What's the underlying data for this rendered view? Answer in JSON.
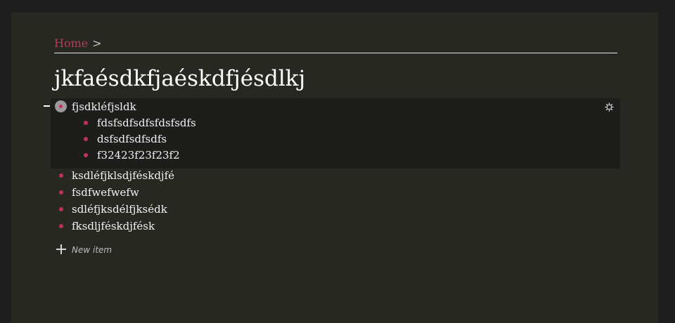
{
  "breadcrumb": {
    "home_label": "Home",
    "separator": ">"
  },
  "page": {
    "title": "jkfaésdkfjaéskdfjésdlkj"
  },
  "focused_item": {
    "label": "fjsdkléfjsldk",
    "children": [
      {
        "label": "fdsfsdfsdfsfdsfsdfs"
      },
      {
        "label": "dsfsdfsdfsdfs"
      },
      {
        "label": "f32423f23f23f2"
      }
    ]
  },
  "items": [
    {
      "label": "ksdléfjklsdjféskdjfé"
    },
    {
      "label": "fsdfwefwefw"
    },
    {
      "label": "sdléfjksdélfjksédk"
    },
    {
      "label": "fksdljféskdjfésk"
    }
  ],
  "new_item": {
    "label": "New item",
    "icon": "plus-icon"
  },
  "icons": {
    "collapse": "minus-icon",
    "settings": "gear-icon",
    "bullet": "bullet-icon"
  },
  "colors": {
    "accent": "#c0325a",
    "link": "#b53a5e",
    "panel": "#272821",
    "focused_background": "#1d1d1b",
    "page_background": "#1e1e1e"
  }
}
